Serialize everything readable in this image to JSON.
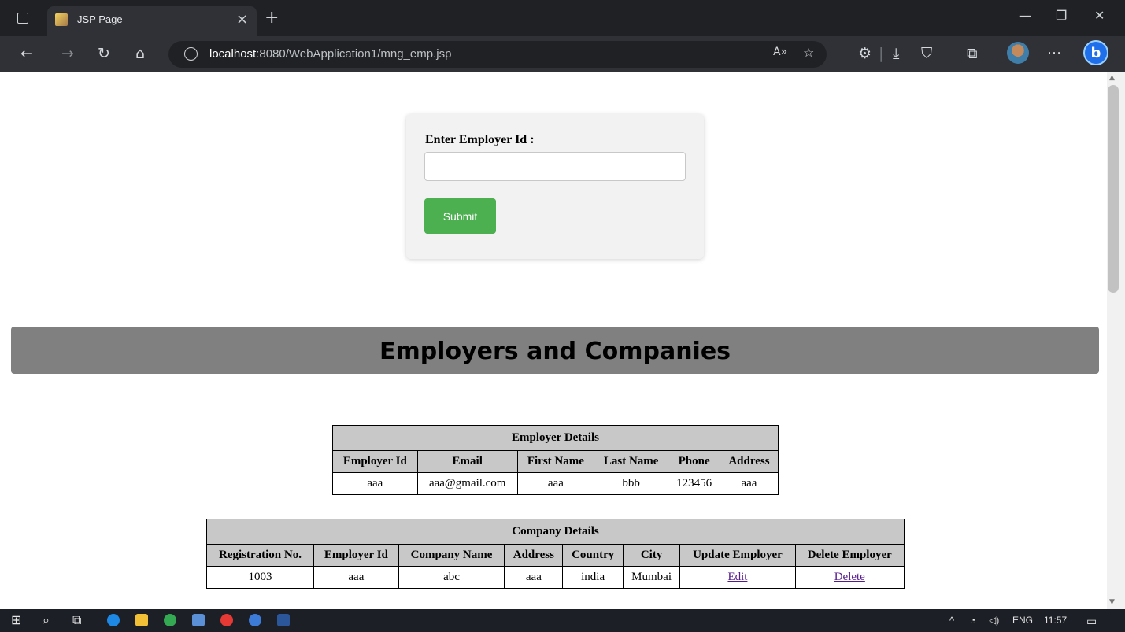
{
  "browser": {
    "tab_title": "JSP Page",
    "close_glyph": "×",
    "new_tab_glyph": "+",
    "url_host": "localhost",
    "url_path": ":8080/WebApplication1/mng_emp.jsp",
    "info_glyph": "i",
    "read_aloud_glyph": "A»",
    "more_glyph": "···",
    "copilot_glyph": "b"
  },
  "form": {
    "label": "Enter Employer Id :",
    "input_value": "",
    "input_placeholder": "",
    "submit_label": "Submit"
  },
  "banner": {
    "title": "Employers and Companies"
  },
  "employer_table": {
    "caption": "Employer Details",
    "columns": [
      "Employer Id",
      "Email",
      "First Name",
      "Last Name",
      "Phone",
      "Address"
    ],
    "rows": [
      [
        "aaa",
        "aaa@gmail.com",
        "aaa",
        "bbb",
        "123456",
        "aaa"
      ]
    ]
  },
  "company_table": {
    "caption": "Company Details",
    "columns": [
      "Registration No.",
      "Employer Id",
      "Company Name",
      "Address",
      "Country",
      "City",
      "Update Employer",
      "Delete Employer"
    ],
    "rows": [
      [
        "1003",
        "aaa",
        "abc",
        "aaa",
        "india",
        "Mumbai",
        "Edit",
        "Delete"
      ]
    ]
  },
  "taskbar": {
    "language": "ENG",
    "time": "11:57"
  },
  "colors": {
    "submit_button": "#4caf50",
    "banner": "#808080",
    "header_cell": "#c8c8c8",
    "link": "#551a8b"
  }
}
